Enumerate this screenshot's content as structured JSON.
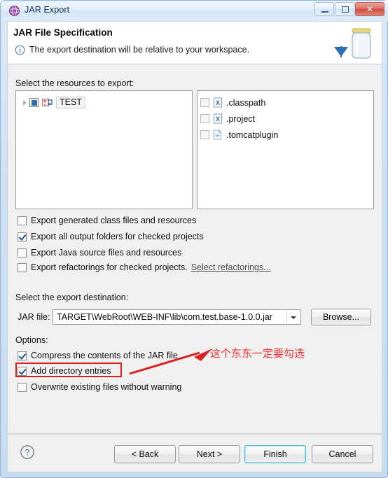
{
  "window": {
    "title": "JAR Export",
    "icon": "eclipse-globe-icon",
    "controls": {
      "minimize": "minimize-button",
      "maximize": "maximize-button",
      "close": "✕"
    }
  },
  "header": {
    "title": "JAR File Specification",
    "info_icon": "info-icon",
    "message": "The export destination will be relative to your workspace.",
    "art": "jar-export-illustration"
  },
  "resources": {
    "label": "Select the resources to export:",
    "tree": [
      {
        "label": "TEST",
        "checkbox_state": "partial",
        "expandable": true,
        "selected": true,
        "icon": "java-project-icon"
      }
    ],
    "files": [
      {
        "label": ".classpath",
        "checked": false,
        "icon": "xml-file-icon"
      },
      {
        "label": ".project",
        "checked": false,
        "icon": "xml-file-icon"
      },
      {
        "label": ".tomcatplugin",
        "checked": false,
        "icon": "text-file-icon"
      }
    ]
  },
  "export_options": [
    {
      "label": "Export generated class files and resources",
      "checked": false
    },
    {
      "label": "Export all output folders for checked projects",
      "checked": true
    },
    {
      "label": "Export Java source files and resources",
      "checked": false
    },
    {
      "label": "Export refactorings for checked projects.",
      "checked": false,
      "link": "Select refactorings..."
    }
  ],
  "destination": {
    "label": "Select the export destination:",
    "field_label": "JAR file:",
    "value": "TARGET\\WebRoot\\WEB-INF\\lib\\com.test.base-1.0.0.jar",
    "browse_label": "Browse..."
  },
  "options": {
    "label": "Options:",
    "items": [
      {
        "label": "Compress the contents of the JAR file",
        "checked": true,
        "highlighted": false
      },
      {
        "label": "Add directory entries",
        "checked": true,
        "highlighted": true
      },
      {
        "label": "Overwrite existing files without warning",
        "checked": false,
        "highlighted": false
      }
    ]
  },
  "footer": {
    "help_icon": "help-question-icon",
    "back_label": "< Back",
    "next_label": "Next >",
    "finish_label": "Finish",
    "cancel_label": "Cancel"
  },
  "annotation": {
    "text": "这个东东一定要勾选",
    "color": "#ef2b2b",
    "arrow": "red-arrow-pointing-to-add-directory-entries"
  }
}
